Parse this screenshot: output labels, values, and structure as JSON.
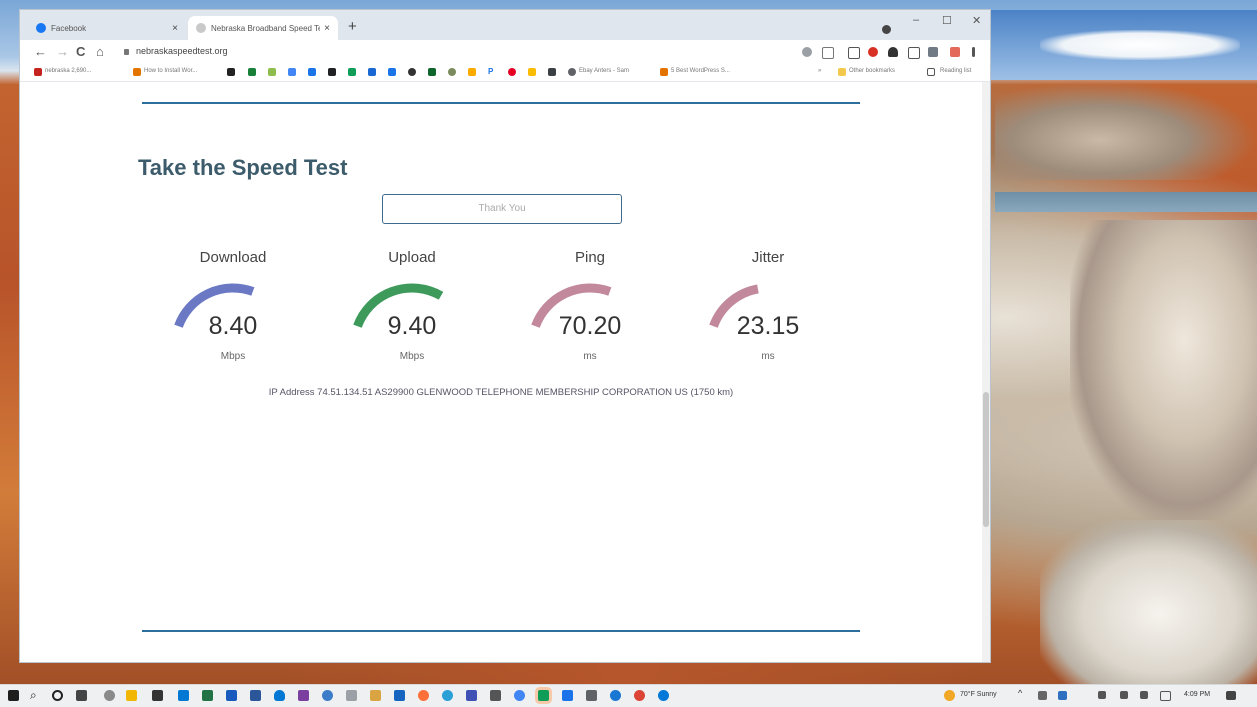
{
  "browser": {
    "tabs": [
      {
        "title": "Facebook",
        "favicon_color": "#1877f2"
      },
      {
        "title": "Nebraska Broadband Speed Test",
        "favicon_color": "#aaaaaa"
      }
    ],
    "new_tab": "+",
    "window_controls": {
      "minimize": "–",
      "maximize": "☐",
      "close": "✕"
    },
    "nav": {
      "back": "←",
      "forward": "→",
      "reload": "C",
      "home": "⌂"
    },
    "url": "nebraskaspeedtest.org",
    "bookmarks": [
      {
        "label": "nebraska 2,690...",
        "color": "#c5221f"
      },
      {
        "label": "How to Install Wor...",
        "color": "#e37400"
      },
      {
        "label": "Ebay Anters - Sam",
        "color": "#5f6368"
      },
      {
        "label": "5 Best WordPress S...",
        "color": "#e37400"
      }
    ],
    "bookmarks_right": {
      "other": "Other bookmarks",
      "reading": "Reading list"
    }
  },
  "page": {
    "heading": "Take the Speed Test",
    "button_label": "Thank You",
    "metrics": [
      {
        "label": "Download",
        "value": "8.40",
        "unit": "Mbps",
        "fraction": 0.45,
        "color": "#6b78c4"
      },
      {
        "label": "Upload",
        "value": "9.40",
        "unit": "Mbps",
        "fraction": 0.5,
        "color": "#3d9a5b"
      },
      {
        "label": "Ping",
        "value": "70.20",
        "unit": "ms",
        "fraction": 0.45,
        "color": "#c2889b"
      },
      {
        "label": "Jitter",
        "value": "23.15",
        "unit": "ms",
        "fraction": 0.3,
        "color": "#c2889b"
      }
    ],
    "ip_line": "IP Address  74.51.134.51   AS29900 GLENWOOD TELEPHONE MEMBERSHIP CORPORATION  US (1750 km)"
  },
  "taskbar": {
    "weather": "70°F  Sunny",
    "time": "4:09 PM"
  }
}
